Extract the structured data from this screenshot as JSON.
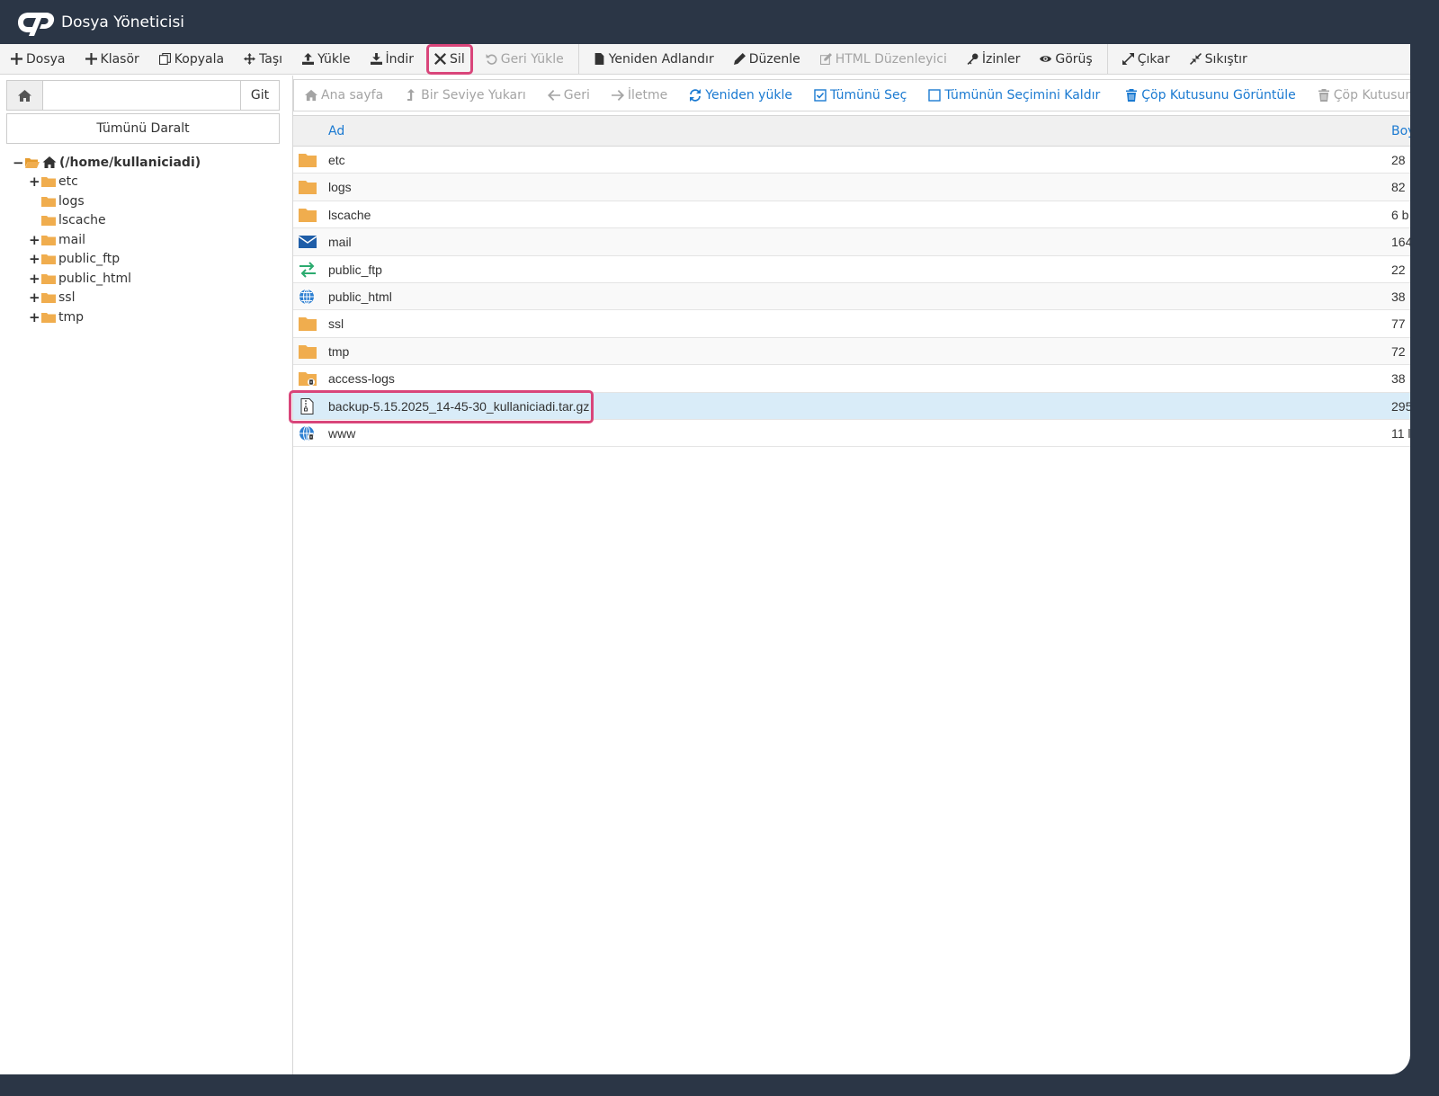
{
  "app": {
    "title": "Dosya Yöneticisi",
    "logo_icon": "cpanel-logo-icon"
  },
  "colors": {
    "header_bg": "#2b3646",
    "accent": "#1b7ad1",
    "highlight": "#d9457a",
    "folder": "#f0ad4e",
    "selected_row": "#d9ecf8"
  },
  "toolbar": [
    {
      "id": "file",
      "label": "Dosya",
      "icon": "plus-icon",
      "disabled": false
    },
    {
      "id": "folder",
      "label": "Klasör",
      "icon": "plus-icon",
      "disabled": false
    },
    {
      "id": "copy",
      "label": "Kopyala",
      "icon": "copy-icon",
      "disabled": false
    },
    {
      "id": "move",
      "label": "Taşı",
      "icon": "move-icon",
      "disabled": false
    },
    {
      "id": "upload",
      "label": "Yükle",
      "icon": "upload-icon",
      "disabled": false
    },
    {
      "id": "download",
      "label": "İndir",
      "icon": "download-icon",
      "disabled": false
    },
    {
      "id": "delete",
      "label": "Sil",
      "icon": "x-icon",
      "disabled": false,
      "highlighted": true
    },
    {
      "id": "restore",
      "label": "Geri Yükle",
      "icon": "undo-icon",
      "disabled": true
    },
    {
      "id": "rename",
      "label": "Yeniden Adlandır",
      "icon": "file-icon",
      "disabled": false
    },
    {
      "id": "edit",
      "label": "Düzenle",
      "icon": "pencil-icon",
      "disabled": false
    },
    {
      "id": "html-editor",
      "label": "HTML Düzenleyici",
      "icon": "edit-square-icon",
      "disabled": true
    },
    {
      "id": "permissions",
      "label": "İzinler",
      "icon": "key-icon",
      "disabled": false
    },
    {
      "id": "view",
      "label": "Görüş",
      "icon": "eye-icon",
      "disabled": false
    },
    {
      "id": "extract",
      "label": "Çıkar",
      "icon": "expand-icon",
      "disabled": false
    },
    {
      "id": "compress",
      "label": "Sıkıştır",
      "icon": "compress-icon",
      "disabled": false
    }
  ],
  "sidebar": {
    "path_value": "",
    "go_label": "Git",
    "collapse_label": "Tümünü Daralt",
    "root": {
      "label": "(/home/kullaniciadi)"
    },
    "tree": [
      {
        "label": "etc",
        "expandable": true
      },
      {
        "label": "logs",
        "expandable": false
      },
      {
        "label": "lscache",
        "expandable": false
      },
      {
        "label": "mail",
        "expandable": true
      },
      {
        "label": "public_ftp",
        "expandable": true
      },
      {
        "label": "public_html",
        "expandable": true
      },
      {
        "label": "ssl",
        "expandable": true
      },
      {
        "label": "tmp",
        "expandable": true
      }
    ]
  },
  "nav": [
    {
      "id": "home",
      "label": "Ana sayfa",
      "icon": "home-icon",
      "active": false
    },
    {
      "id": "up",
      "label": "Bir Seviye Yukarı",
      "icon": "level-up-icon",
      "active": false
    },
    {
      "id": "back",
      "label": "Geri",
      "icon": "arrow-left-icon",
      "active": false
    },
    {
      "id": "forward",
      "label": "İletme",
      "icon": "arrow-right-icon",
      "active": false
    },
    {
      "id": "reload",
      "label": "Yeniden yükle",
      "icon": "refresh-icon",
      "active": true
    },
    {
      "id": "select-all",
      "label": "Tümünü Seç",
      "icon": "checkbox-checked-icon",
      "active": true
    },
    {
      "id": "deselect-all",
      "label": "Tümünün Seçimini Kaldır",
      "icon": "checkbox-empty-icon",
      "active": true
    },
    {
      "id": "view-trash",
      "label": "Çöp Kutusunu Görüntüle",
      "icon": "trash-icon",
      "active": true
    },
    {
      "id": "empty-trash",
      "label": "Çöp Kutusunu Boşalt",
      "icon": "trash-icon",
      "active": false
    }
  ],
  "table": {
    "headers": {
      "name": "Ad",
      "size": "Boy"
    },
    "rows": [
      {
        "name": "etc",
        "size": "28",
        "icon": "folder-icon"
      },
      {
        "name": "logs",
        "size": "82",
        "icon": "folder-icon"
      },
      {
        "name": "lscache",
        "size": "6 b",
        "icon": "folder-icon"
      },
      {
        "name": "mail",
        "size": "164",
        "icon": "mail-icon"
      },
      {
        "name": "public_ftp",
        "size": "22",
        "icon": "transfer-icon"
      },
      {
        "name": "public_html",
        "size": "38",
        "icon": "globe-icon"
      },
      {
        "name": "ssl",
        "size": "77",
        "icon": "folder-icon"
      },
      {
        "name": "tmp",
        "size": "72",
        "icon": "folder-icon"
      },
      {
        "name": "access-logs",
        "size": "38",
        "icon": "folder-link-icon"
      },
      {
        "name": "backup-5.15.2025_14-45-30_kullaniciadi.tar.gz",
        "size": "295",
        "icon": "archive-file-icon",
        "selected": true
      },
      {
        "name": "www",
        "size": "11 l",
        "icon": "globe-link-icon"
      }
    ]
  }
}
